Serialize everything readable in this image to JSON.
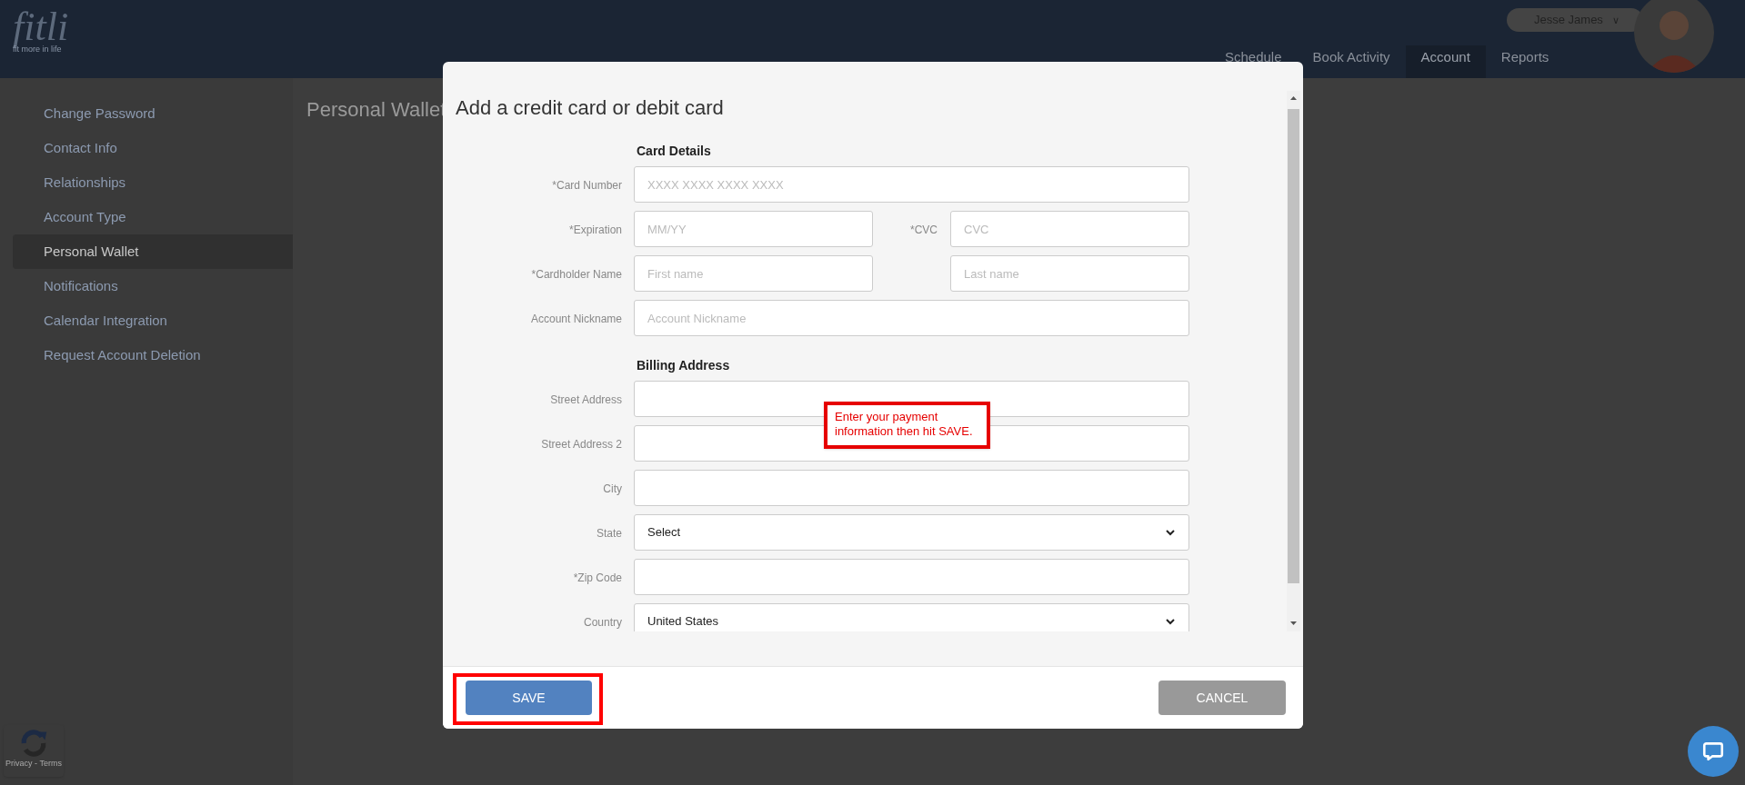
{
  "header": {
    "logo": "fitli",
    "tagline": "fit more in life",
    "user_name": "Jesse James",
    "user_caret": "∨",
    "nav": [
      {
        "label": "Schedule",
        "selected": false
      },
      {
        "label": "Book Activity",
        "selected": false
      },
      {
        "label": "Account",
        "selected": true
      },
      {
        "label": "Reports",
        "selected": false
      }
    ]
  },
  "sidebar": {
    "items": [
      {
        "label": "Change Password",
        "selected": false
      },
      {
        "label": "Contact Info",
        "selected": false
      },
      {
        "label": "Relationships",
        "selected": false
      },
      {
        "label": "Account Type",
        "selected": false
      },
      {
        "label": "Personal Wallet",
        "selected": true
      },
      {
        "label": "Notifications",
        "selected": false
      },
      {
        "label": "Calendar Integration",
        "selected": false
      },
      {
        "label": "Request Account Deletion",
        "selected": false
      }
    ]
  },
  "page_title": "Personal Wallet",
  "modal": {
    "title": "Add a credit card or debit card",
    "sections": [
      {
        "heading": "Card Details",
        "rows": [
          {
            "label": "*Card Number",
            "fields": [
              {
                "kind": "input",
                "placeholder": "XXXX XXXX XXXX XXXX"
              }
            ]
          },
          {
            "label": "*Expiration",
            "fields": [
              {
                "kind": "input",
                "placeholder": "MM/YY"
              },
              {
                "kind": "input",
                "label": "*CVC",
                "placeholder": "CVC"
              }
            ]
          },
          {
            "label": "*Cardholder Name",
            "fields": [
              {
                "kind": "input",
                "placeholder": "First name"
              },
              {
                "kind": "input",
                "placeholder": "Last name"
              }
            ]
          },
          {
            "label": "Account Nickname",
            "fields": [
              {
                "kind": "input",
                "placeholder": "Account Nickname"
              }
            ]
          }
        ]
      },
      {
        "heading": "Billing Address",
        "rows": [
          {
            "label": "Street Address",
            "fields": [
              {
                "kind": "input"
              }
            ]
          },
          {
            "label": "Street Address 2",
            "fields": [
              {
                "kind": "input"
              }
            ]
          },
          {
            "label": "City",
            "fields": [
              {
                "kind": "input"
              }
            ]
          },
          {
            "label": "State",
            "fields": [
              {
                "kind": "select",
                "value": "Select"
              }
            ]
          },
          {
            "label": "*Zip Code",
            "fields": [
              {
                "kind": "input"
              }
            ]
          },
          {
            "label": "Country",
            "fields": [
              {
                "kind": "select",
                "value": "United States"
              }
            ]
          }
        ]
      }
    ],
    "callout": "Enter your payment information then hit SAVE.",
    "save_button": "SAVE",
    "save_highlighted": true,
    "cancel_button": "CANCEL"
  },
  "recaptcha": "Privacy - Terms"
}
